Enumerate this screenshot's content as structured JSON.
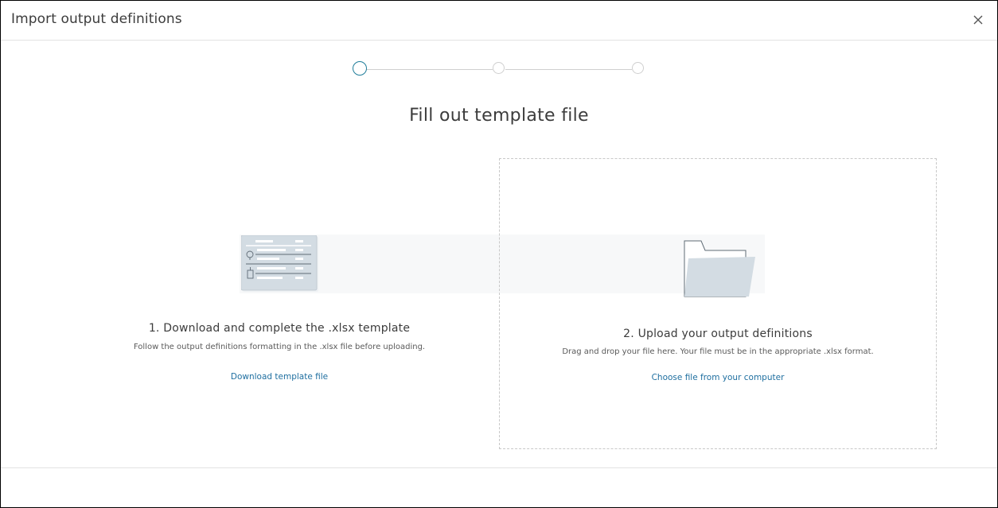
{
  "dialog": {
    "title": "Import output definitions",
    "close_icon": "close-icon"
  },
  "stepper": {
    "steps": [
      {
        "state": "active"
      },
      {
        "state": "inactive"
      },
      {
        "state": "inactive"
      }
    ],
    "active_color": "#1f7d9a"
  },
  "main": {
    "heading": "Fill out template file",
    "download": {
      "icon": "template-file-icon",
      "title": "1. Download and complete the .xlsx template",
      "description": "Follow the output definitions formatting in the .xlsx file before uploading.",
      "link": "Download template file"
    },
    "upload": {
      "icon": "folder-icon",
      "title": "2. Upload your output definitions",
      "description": "Drag and drop your file here. Your file must be in the appropriate .xlsx format.",
      "link": "Choose file from your computer"
    }
  },
  "colors": {
    "link": "#1f6fa0",
    "accent": "#1f7d9a",
    "illustration": "#d3dce3"
  }
}
